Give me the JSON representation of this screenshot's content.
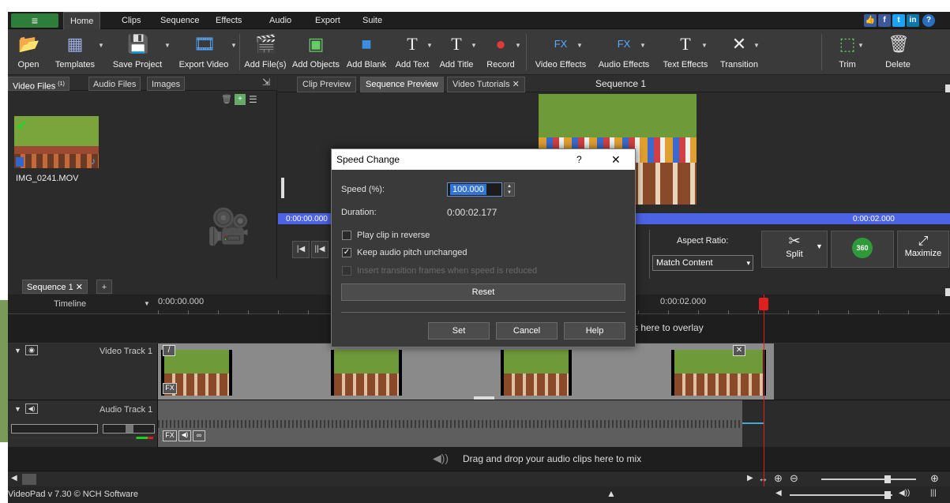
{
  "menubar": {
    "tabs": [
      "Home",
      "Clips",
      "Sequence",
      "Effects",
      "Audio",
      "Export",
      "Suite"
    ],
    "social_icons": [
      "thumbs-up-icon",
      "facebook-icon",
      "twitter-icon",
      "linkedin-icon",
      "help-icon"
    ]
  },
  "toolbar": {
    "open": "Open",
    "templates": "Templates",
    "save_project": "Save Project",
    "export_video": "Export Video",
    "add_files": "Add File(s)",
    "add_objects": "Add Objects",
    "add_blank": "Add Blank",
    "add_text": "Add Text",
    "add_title": "Add Title",
    "record": "Record",
    "video_effects": "Video Effects",
    "audio_effects": "Audio Effects",
    "text_effects": "Text Effects",
    "transition": "Transition",
    "trim": "Trim",
    "delete": "Delete"
  },
  "media": {
    "tabs": [
      "Video Files",
      "Audio Files",
      "Images"
    ],
    "video_files_count": "(1)",
    "file_name": "IMG_0241.MOV"
  },
  "preview": {
    "tabs": [
      "Clip Preview",
      "Sequence Preview",
      "Video Tutorials"
    ],
    "title": "Sequence 1",
    "time_start": "0:00:00.000",
    "time_end": "0:00:02.000",
    "aspect_label": "Aspect Ratio:",
    "aspect_value": "Match Content",
    "split": "Split",
    "maximize": "Maximize",
    "badge_360": "360"
  },
  "sequence": {
    "tab": "Sequence 1",
    "timeline_label": "Timeline",
    "time_start": "0:00:00.000",
    "time_mark": "0:00:02.000",
    "overlay_hint": "s here to overlay",
    "video_track": "Video Track 1",
    "audio_track": "Audio Track 1",
    "audio_drop_hint": "Drag and drop your audio clips here to mix",
    "fx_label": "FX"
  },
  "status": {
    "version": "VideoPad v 7.30 © NCH Software"
  },
  "dialog": {
    "title": "Speed Change",
    "help_glyph": "?",
    "close_glyph": "✕",
    "speed_label": "Speed (%):",
    "speed_value": "100.000",
    "duration_label": "Duration:",
    "duration_value": "0:00:02.177",
    "reverse_label": "Play clip in reverse",
    "reverse_checked": false,
    "pitch_label": "Keep audio pitch unchanged",
    "pitch_checked": true,
    "transition_label": "Insert transition frames when speed is reduced",
    "transition_enabled": false,
    "reset": "Reset",
    "set": "Set",
    "cancel": "Cancel",
    "help": "Help"
  },
  "colors": {
    "accent_green": "#2f7d3a",
    "scrub_blue": "#4d63e6",
    "playhead_red": "#e02020",
    "selection_blue": "#3375d6"
  }
}
